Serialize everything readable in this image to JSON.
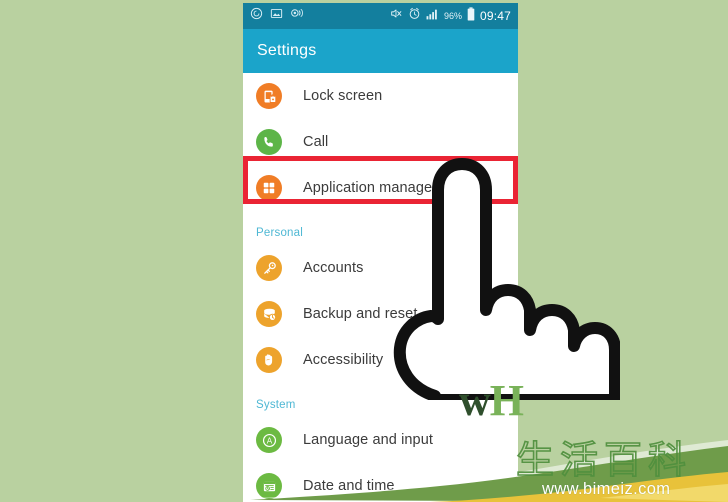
{
  "background_color": "#b9d1a0",
  "phone": {
    "statusbar": {
      "background_color": "#137f9e",
      "left_icons": [
        {
          "name": "data-saver-icon",
          "glyph": "circle-spiral"
        },
        {
          "name": "screenshot-captured-icon",
          "glyph": "image"
        },
        {
          "name": "smart-stay-icon",
          "glyph": "eye-tracking"
        }
      ],
      "right_icons": [
        {
          "name": "mute-icon",
          "glyph": "bell-slash"
        },
        {
          "name": "alarm-icon",
          "glyph": "clock"
        },
        {
          "name": "signal-icon",
          "glyph": "bars"
        }
      ],
      "battery_percent": "96%",
      "clock": "09:47"
    },
    "appbar": {
      "title": "Settings",
      "background_color": "#1ba4ca"
    },
    "sections": [
      {
        "header": null,
        "items": [
          {
            "label": "Lock screen",
            "icon": "lock-screen-icon",
            "icon_color": "#f07d26"
          },
          {
            "label": "Call",
            "icon": "phone-icon",
            "icon_color": "#5db548"
          },
          {
            "label": "Application manager",
            "icon": "application-manager-icon",
            "icon_color": "#f07d26",
            "highlighted": true
          }
        ]
      },
      {
        "header": "Personal",
        "items": [
          {
            "label": "Accounts",
            "icon": "key-icon",
            "icon_color": "#eda32c"
          },
          {
            "label": "Backup and reset",
            "icon": "backup-restore-icon",
            "icon_color": "#eda32c"
          },
          {
            "label": "Accessibility",
            "icon": "hand-icon",
            "icon_color": "#eda32c"
          }
        ]
      },
      {
        "header": "System",
        "items": [
          {
            "label": "Language and input",
            "icon": "language-icon",
            "icon_color": "#6cba42"
          },
          {
            "label": "Date and time",
            "icon": "calendar-clock-icon",
            "icon_color": "#6cba42"
          }
        ]
      }
    ]
  },
  "annotations": {
    "highlight_color": "#ea2434",
    "highlight_target": "Application manager",
    "cursor": "pointing-hand"
  },
  "branding": {
    "wikihow_w": "w",
    "wikihow_h": "H"
  },
  "watermark": {
    "chinese_text": "生活百科",
    "url": "www.bimeiz.com",
    "color": "#4f8f3e"
  }
}
